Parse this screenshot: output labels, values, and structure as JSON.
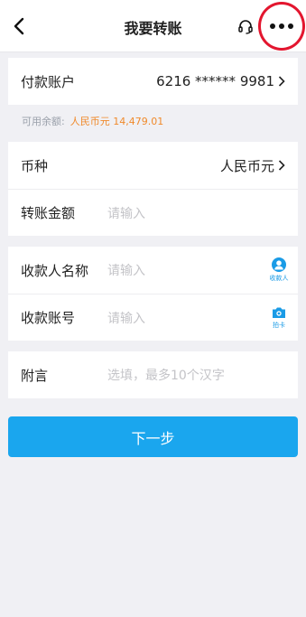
{
  "header": {
    "title": "我要转账",
    "back_icon": "chevron-left-icon",
    "service_icon": "headset-icon",
    "more_icon": "more-dots-icon",
    "highlight_color": "#e3162f"
  },
  "payer": {
    "label": "付款账户",
    "account": "6216 ****** 9981"
  },
  "balance": {
    "label": "可用余额:",
    "value": "人民币元 14,479.01"
  },
  "currency": {
    "label": "币种",
    "value": "人民币元"
  },
  "amount": {
    "label": "转账金额",
    "placeholder": "请输入"
  },
  "payee_name": {
    "label": "收款人名称",
    "placeholder": "请输入",
    "action_label": "收款人"
  },
  "payee_account": {
    "label": "收款账号",
    "placeholder": "请输入",
    "action_label": "拍卡"
  },
  "note": {
    "label": "附言",
    "placeholder": "选填，最多10个汉字"
  },
  "next_button": {
    "label": "下一步",
    "color": "#1aa6ee"
  }
}
